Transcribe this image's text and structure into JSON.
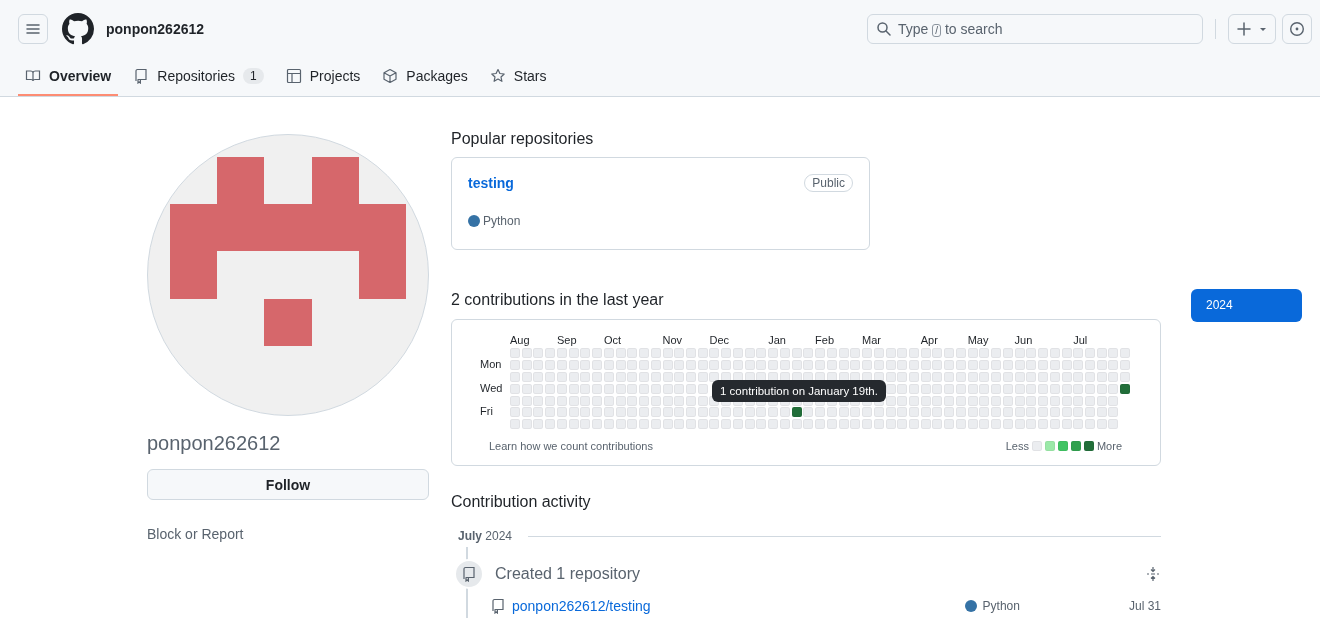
{
  "header": {
    "username": "ponpon262612",
    "search": {
      "placeholder_parts": [
        "Type",
        "/",
        "to search"
      ]
    }
  },
  "tabs": [
    {
      "label": "Overview",
      "selected": true
    },
    {
      "label": "Repositories",
      "count": "1",
      "selected": false
    },
    {
      "label": "Projects",
      "selected": false
    },
    {
      "label": "Packages",
      "selected": false
    },
    {
      "label": "Stars",
      "selected": false
    }
  ],
  "profile": {
    "name": "ponpon262612",
    "follow_button": "Follow",
    "block_link": "Block or Report"
  },
  "popular": {
    "title": "Popular repositories",
    "repos": [
      {
        "name": "testing",
        "visibility": "Public",
        "language": "Python",
        "color": "#3572a5"
      }
    ]
  },
  "contributions": {
    "title": "2 contributions in the last year",
    "day_labels": [
      "Mon",
      "Wed",
      "Fri"
    ],
    "weeks": [
      {
        "month": "Aug",
        "days": [
          false,
          false,
          false,
          false,
          false,
          false,
          false
        ]
      },
      {
        "days": [
          false,
          false,
          false,
          false,
          false,
          false,
          false
        ]
      },
      {
        "days": [
          false,
          false,
          false,
          false,
          false,
          false,
          false
        ]
      },
      {
        "days": [
          false,
          false,
          false,
          false,
          false,
          false,
          false
        ]
      },
      {
        "month": "Sep",
        "days": [
          false,
          false,
          false,
          false,
          false,
          false,
          false
        ]
      },
      {
        "days": [
          false,
          false,
          false,
          false,
          false,
          false,
          false
        ]
      },
      {
        "days": [
          false,
          false,
          false,
          false,
          false,
          false,
          false
        ]
      },
      {
        "days": [
          false,
          false,
          false,
          false,
          false,
          false,
          false
        ]
      },
      {
        "month": "Oct",
        "days": [
          false,
          false,
          false,
          false,
          false,
          false,
          false
        ]
      },
      {
        "days": [
          false,
          false,
          false,
          false,
          false,
          false,
          false
        ]
      },
      {
        "days": [
          false,
          false,
          false,
          false,
          false,
          false,
          false
        ]
      },
      {
        "days": [
          false,
          false,
          false,
          false,
          false,
          false,
          false
        ]
      },
      {
        "days": [
          false,
          false,
          false,
          false,
          false,
          false,
          false
        ]
      },
      {
        "month": "Nov",
        "days": [
          false,
          false,
          false,
          false,
          false,
          false,
          false
        ]
      },
      {
        "days": [
          false,
          false,
          false,
          false,
          false,
          false,
          false
        ]
      },
      {
        "days": [
          false,
          false,
          false,
          false,
          false,
          false,
          false
        ]
      },
      {
        "days": [
          false,
          false,
          false,
          false,
          false,
          false,
          false
        ]
      },
      {
        "month": "Dec",
        "under_tooltip": true,
        "days": [
          false,
          false,
          false,
          false,
          false,
          false
        ]
      },
      {
        "under_tooltip": true,
        "days": [
          false,
          false,
          false,
          false,
          false,
          false
        ]
      },
      {
        "under_tooltip": true,
        "days": [
          false,
          false,
          false,
          false,
          false,
          false
        ]
      },
      {
        "under_tooltip": true,
        "days": [
          false,
          false,
          false,
          false,
          false,
          false
        ]
      },
      {
        "under_tooltip": true,
        "days": [
          false,
          false,
          false,
          false,
          false,
          false
        ]
      },
      {
        "month": "Jan",
        "under_tooltip": true,
        "days": [
          false,
          false,
          false,
          false,
          false,
          false
        ]
      },
      {
        "under_tooltip": true,
        "days": [
          false,
          false,
          false,
          false,
          false,
          false
        ]
      },
      {
        "under_tooltip": true,
        "days": [
          false,
          false,
          false,
          false,
          true,
          false
        ]
      },
      {
        "under_tooltip": true,
        "days": [
          false,
          false,
          false,
          false,
          false,
          false
        ]
      },
      {
        "month": "Feb",
        "under_tooltip": true,
        "days": [
          false,
          false,
          false,
          false,
          false,
          false
        ]
      },
      {
        "under_tooltip": true,
        "days": [
          false,
          false,
          false,
          false,
          false,
          false
        ]
      },
      {
        "under_tooltip": true,
        "days": [
          false,
          false,
          false,
          false,
          false,
          false
        ]
      },
      {
        "under_tooltip": true,
        "days": [
          false,
          false,
          false,
          false,
          false,
          false
        ]
      },
      {
        "month": "Mar",
        "under_tooltip": true,
        "days": [
          false,
          false,
          false,
          false,
          false,
          false
        ]
      },
      {
        "under_tooltip": true,
        "days": [
          false,
          false,
          false,
          false,
          false,
          false
        ]
      },
      {
        "days": [
          false,
          false,
          false,
          false,
          false,
          false,
          false
        ]
      },
      {
        "days": [
          false,
          false,
          false,
          false,
          false,
          false,
          false
        ]
      },
      {
        "days": [
          false,
          false,
          false,
          false,
          false,
          false,
          false
        ]
      },
      {
        "month": "Apr",
        "days": [
          false,
          false,
          false,
          false,
          false,
          false,
          false
        ]
      },
      {
        "days": [
          false,
          false,
          false,
          false,
          false,
          false,
          false
        ]
      },
      {
        "days": [
          false,
          false,
          false,
          false,
          false,
          false,
          false
        ]
      },
      {
        "days": [
          false,
          false,
          false,
          false,
          false,
          false,
          false
        ]
      },
      {
        "month": "May",
        "days": [
          false,
          false,
          false,
          false,
          false,
          false,
          false
        ]
      },
      {
        "days": [
          false,
          false,
          false,
          false,
          false,
          false,
          false
        ]
      },
      {
        "days": [
          false,
          false,
          false,
          false,
          false,
          false,
          false
        ]
      },
      {
        "days": [
          false,
          false,
          false,
          false,
          false,
          false,
          false
        ]
      },
      {
        "month": "Jun",
        "days": [
          false,
          false,
          false,
          false,
          false,
          false,
          false
        ]
      },
      {
        "days": [
          false,
          false,
          false,
          false,
          false,
          false,
          false
        ]
      },
      {
        "days": [
          false,
          false,
          false,
          false,
          false,
          false,
          false
        ]
      },
      {
        "days": [
          false,
          false,
          false,
          false,
          false,
          false,
          false
        ]
      },
      {
        "days": [
          false,
          false,
          false,
          false,
          false,
          false,
          false
        ]
      },
      {
        "month": "Jul",
        "days": [
          false,
          false,
          false,
          false,
          false,
          false,
          false
        ]
      },
      {
        "days": [
          false,
          false,
          false,
          false,
          false,
          false,
          false
        ]
      },
      {
        "days": [
          false,
          false,
          false,
          false,
          false,
          false,
          false
        ]
      },
      {
        "days": [
          false,
          false,
          false,
          false,
          false,
          false,
          false
        ]
      },
      {
        "days": [
          false,
          false,
          false,
          true
        ]
      }
    ],
    "tooltip": "1 contribution on January 19th.",
    "learn_link": "Learn how we count contributions",
    "legend": {
      "less": "Less",
      "more": "More",
      "colors": [
        {
          "color": "#ebedf0"
        },
        {
          "color": "#9be9a8"
        },
        {
          "color": "#40c463"
        },
        {
          "color": "#30a14e"
        },
        {
          "color": "#216e39"
        }
      ]
    }
  },
  "years": [
    {
      "label": "2024",
      "selected": true
    }
  ],
  "activity": {
    "title": "Contribution activity",
    "period": "**July** 2024",
    "events": [
      {
        "title": "Created 1 repository",
        "repos": [
          {
            "name": "ponpon262612/testing",
            "language": "Python",
            "color": "#3572a5",
            "date": "Jul 31"
          }
        ]
      }
    ]
  }
}
